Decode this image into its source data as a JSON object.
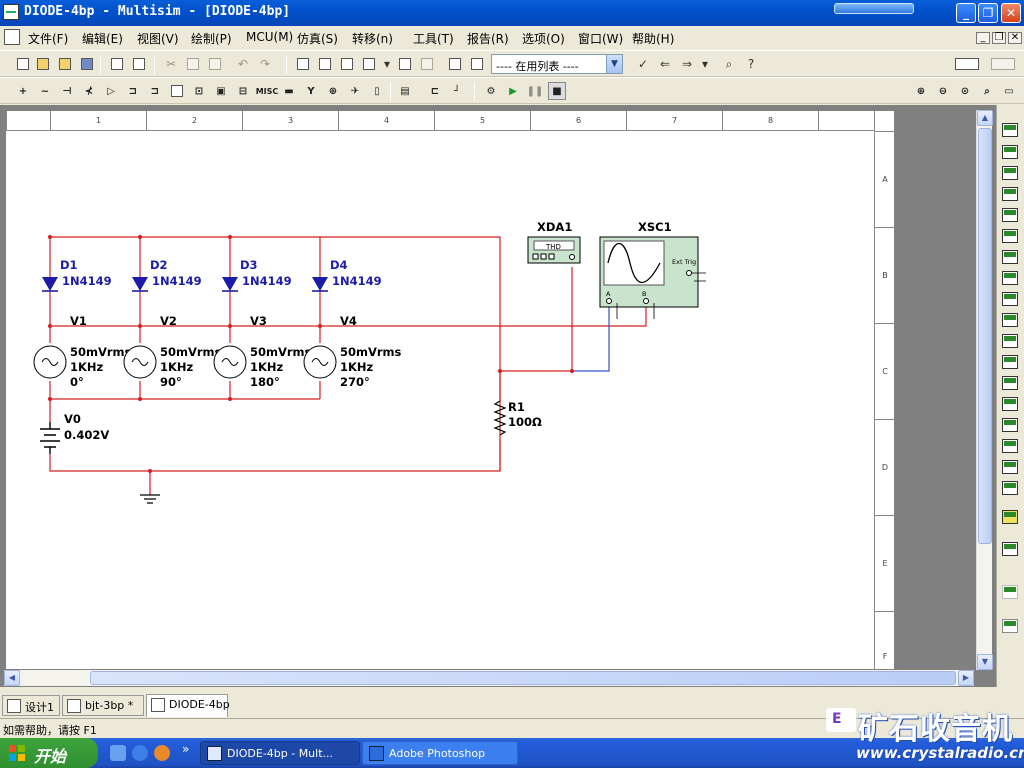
{
  "window": {
    "title": "DIODE-4bp - Multisim - [DIODE-4bp]",
    "minimize_glyph": "_",
    "restore_glyph": "❐",
    "close_glyph": "✕"
  },
  "menu": {
    "items": [
      "文件(F)",
      "编辑(E)",
      "视图(V)",
      "绘制(P)",
      "MCU(M)",
      "仿真(S)",
      "转移(n)",
      "工具(T)",
      "报告(R)",
      "选项(O)",
      "窗口(W)",
      "帮助(H)"
    ],
    "mdi_min": "_",
    "mdi_restore": "❐",
    "mdi_close": "✕"
  },
  "toolbar": {
    "inuse_list": "---- 在用列表 ----",
    "misc_label": "MISC"
  },
  "sheet": {
    "columns": [
      "1",
      "2",
      "3",
      "4",
      "5",
      "6",
      "7",
      "8"
    ],
    "rows": [
      "A",
      "B",
      "C",
      "D",
      "E",
      "F"
    ]
  },
  "circuit": {
    "diodes": [
      {
        "ref": "D1",
        "model": "1N4149"
      },
      {
        "ref": "D2",
        "model": "1N4149"
      },
      {
        "ref": "D3",
        "model": "1N4149"
      },
      {
        "ref": "D4",
        "model": "1N4149"
      }
    ],
    "sources": [
      {
        "ref": "V1",
        "amp": "50mVrms",
        "freq": "1KHz",
        "phase": "0°"
      },
      {
        "ref": "V2",
        "amp": "50mVrms",
        "freq": "1KHz",
        "phase": "90°"
      },
      {
        "ref": "V3",
        "amp": "50mVrms",
        "freq": "1KHz",
        "phase": "180°"
      },
      {
        "ref": "V4",
        "amp": "50mVrms",
        "freq": "1KHz",
        "phase": "270°"
      }
    ],
    "battery": {
      "ref": "V0",
      "value": "0.402V"
    },
    "resistor": {
      "ref": "R1",
      "value": "100Ω"
    },
    "distortion_analyzer": {
      "ref": "XDA1",
      "display": "THD"
    },
    "oscilloscope": {
      "ref": "XSC1",
      "ext_trig": "Ext Trig",
      "ch_a": "A",
      "ch_b": "B"
    }
  },
  "tabs": [
    {
      "label": "设计1"
    },
    {
      "label": "bjt-3bp *"
    },
    {
      "label": "DIODE-4bp"
    }
  ],
  "status": {
    "text": "如需帮助，请按 F1"
  },
  "taskbar": {
    "start": "开始",
    "more": "»",
    "windows": [
      {
        "label": "DIODE-4bp - Mult..."
      },
      {
        "label": "Adobe Photoshop"
      }
    ]
  },
  "watermark": {
    "badge": "E",
    "text": "矿石收音机",
    "url": "www.crystalradio.cn"
  },
  "colors": {
    "wire_red": "#d42020",
    "wire_blue": "#3b4fc8",
    "label_blue": "#1c1ca8",
    "instrument_bg": "#c8e4cc",
    "titlebar": "#0052cc",
    "taskbar": "#245edb",
    "start_green": "#3ea43e"
  }
}
